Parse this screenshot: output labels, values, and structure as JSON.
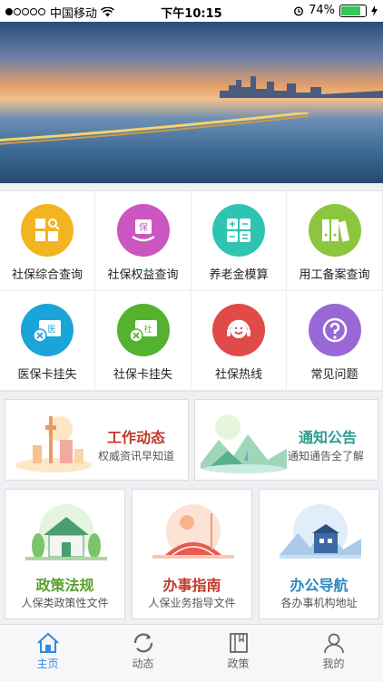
{
  "status_bar": {
    "carrier": "中国移动",
    "time": "下午10:15",
    "battery": "74%"
  },
  "banner": {
    "slide_count": 4,
    "active_slide": 3
  },
  "grid": [
    {
      "label": "社保综合查询",
      "icon": "grid-search-icon",
      "color": "#f3b422"
    },
    {
      "label": "社保权益查询",
      "icon": "bag-shield-icon",
      "color": "#cc55c0"
    },
    {
      "label": "养老金模算",
      "icon": "calculator-icon",
      "color": "#2fc4b2"
    },
    {
      "label": "用工备案查询",
      "icon": "binders-icon",
      "color": "#8cc63f"
    },
    {
      "label": "医保卡挂失",
      "icon": "medical-card-icon",
      "color": "#1aa4d8"
    },
    {
      "label": "社保卡挂失",
      "icon": "social-card-icon",
      "color": "#53b32e"
    },
    {
      "label": "社保热线",
      "icon": "headset-icon",
      "color": "#e04a48"
    },
    {
      "label": "常见问题",
      "icon": "question-icon",
      "color": "#9a68d6"
    }
  ],
  "cards_top": [
    {
      "title": "工作动态",
      "subtitle": "权威资讯早知道",
      "title_color": "#c0392b"
    },
    {
      "title": "通知公告",
      "subtitle": "通知通告全了解",
      "title_color": "#2a9d8f"
    }
  ],
  "cards_bottom": [
    {
      "title": "政策法规",
      "subtitle": "人保类政策性文件",
      "title_color": "#5a9e2f"
    },
    {
      "title": "办事指南",
      "subtitle": "人保业务指导文件",
      "title_color": "#c0392b"
    },
    {
      "title": "办公导航",
      "subtitle": "各办事机构地址",
      "title_color": "#2e86c1"
    }
  ],
  "tabs": [
    {
      "label": "主页",
      "icon": "home-icon",
      "active": true
    },
    {
      "label": "动态",
      "icon": "refresh-icon",
      "active": false
    },
    {
      "label": "政策",
      "icon": "book-icon",
      "active": false
    },
    {
      "label": "我的",
      "icon": "user-icon",
      "active": false
    }
  ]
}
